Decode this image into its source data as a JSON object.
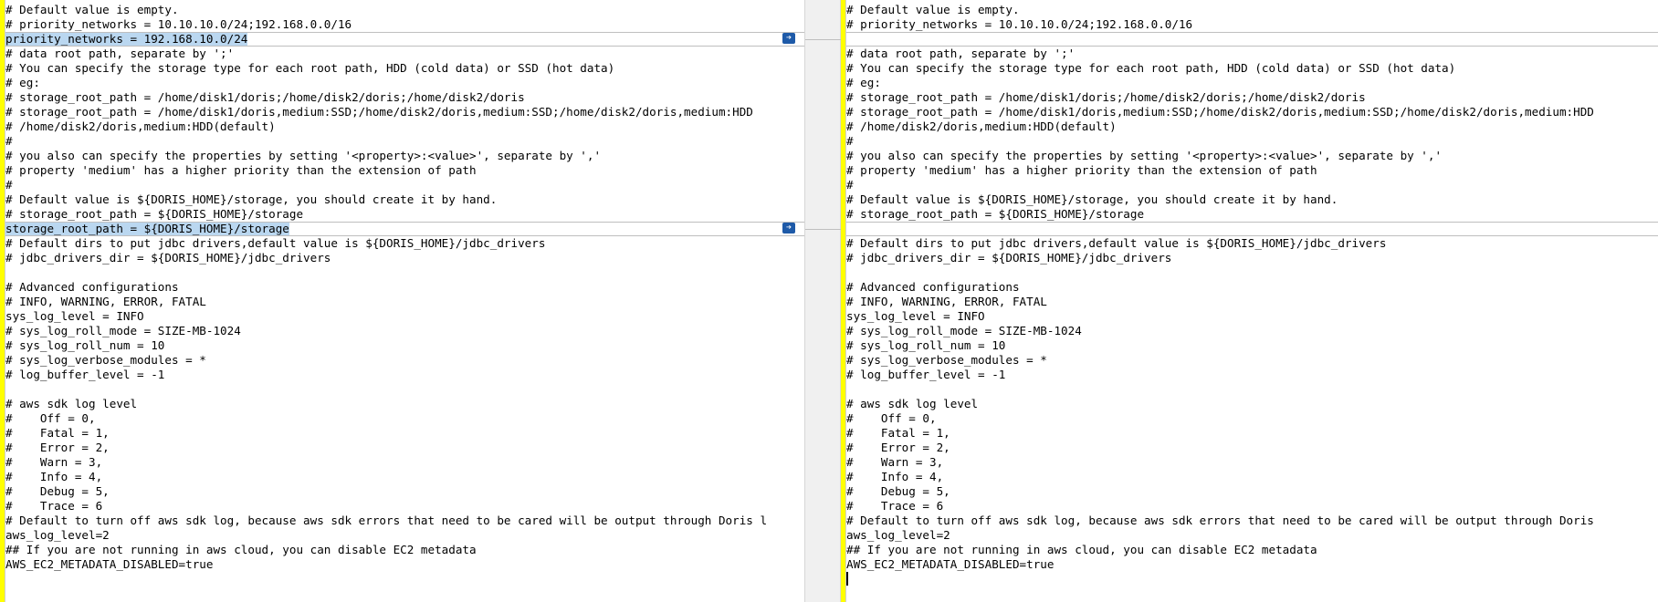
{
  "left": {
    "lines": [
      {
        "text": "# Default value is empty.",
        "changed": false
      },
      {
        "text": "# priority_networks = 10.10.10.0/24;192.168.0.0/16",
        "changed": false
      },
      {
        "text": "priority_networks = 192.168.10.0/24",
        "changed": true
      },
      {
        "text": "# data root path, separate by ';'",
        "changed": false
      },
      {
        "text": "# You can specify the storage type for each root path, HDD (cold data) or SSD (hot data)",
        "changed": false
      },
      {
        "text": "# eg:",
        "changed": false
      },
      {
        "text": "# storage_root_path = /home/disk1/doris;/home/disk2/doris;/home/disk2/doris",
        "changed": false
      },
      {
        "text": "# storage_root_path = /home/disk1/doris,medium:SSD;/home/disk2/doris,medium:SSD;/home/disk2/doris,medium:HDD",
        "changed": false
      },
      {
        "text": "# /home/disk2/doris,medium:HDD(default)",
        "changed": false
      },
      {
        "text": "#",
        "changed": false
      },
      {
        "text": "# you also can specify the properties by setting '<property>:<value>', separate by ','",
        "changed": false
      },
      {
        "text": "# property 'medium' has a higher priority than the extension of path",
        "changed": false
      },
      {
        "text": "#",
        "changed": false
      },
      {
        "text": "# Default value is ${DORIS_HOME}/storage, you should create it by hand.",
        "changed": false
      },
      {
        "text": "# storage_root_path = ${DORIS_HOME}/storage",
        "changed": false
      },
      {
        "text": "storage_root_path = ${DORIS_HOME}/storage",
        "changed": true
      },
      {
        "text": "# Default dirs to put jdbc drivers,default value is ${DORIS_HOME}/jdbc_drivers",
        "changed": false
      },
      {
        "text": "# jdbc_drivers_dir = ${DORIS_HOME}/jdbc_drivers",
        "changed": false
      },
      {
        "text": "",
        "changed": false
      },
      {
        "text": "# Advanced configurations",
        "changed": false
      },
      {
        "text": "# INFO, WARNING, ERROR, FATAL",
        "changed": false
      },
      {
        "text": "sys_log_level = INFO",
        "changed": false
      },
      {
        "text": "# sys_log_roll_mode = SIZE-MB-1024",
        "changed": false
      },
      {
        "text": "# sys_log_roll_num = 10",
        "changed": false
      },
      {
        "text": "# sys_log_verbose_modules = *",
        "changed": false
      },
      {
        "text": "# log_buffer_level = -1",
        "changed": false
      },
      {
        "text": "",
        "changed": false
      },
      {
        "text": "# aws sdk log level",
        "changed": false
      },
      {
        "text": "#    Off = 0,",
        "changed": false
      },
      {
        "text": "#    Fatal = 1,",
        "changed": false
      },
      {
        "text": "#    Error = 2,",
        "changed": false
      },
      {
        "text": "#    Warn = 3,",
        "changed": false
      },
      {
        "text": "#    Info = 4,",
        "changed": false
      },
      {
        "text": "#    Debug = 5,",
        "changed": false
      },
      {
        "text": "#    Trace = 6",
        "changed": false
      },
      {
        "text": "# Default to turn off aws sdk log, because aws sdk errors that need to be cared will be output through Doris l",
        "changed": false
      },
      {
        "text": "aws_log_level=2",
        "changed": false
      },
      {
        "text": "## If you are not running in aws cloud, you can disable EC2 metadata",
        "changed": false
      },
      {
        "text": "AWS_EC2_METADATA_DISABLED=true",
        "changed": false
      }
    ]
  },
  "right": {
    "lines": [
      {
        "text": "# Default value is empty.",
        "changed": false
      },
      {
        "text": "# priority_networks = 10.10.10.0/24;192.168.0.0/16",
        "changed": false
      },
      {
        "text": "",
        "changed": true
      },
      {
        "text": "# data root path, separate by ';'",
        "changed": false
      },
      {
        "text": "# You can specify the storage type for each root path, HDD (cold data) or SSD (hot data)",
        "changed": false
      },
      {
        "text": "# eg:",
        "changed": false
      },
      {
        "text": "# storage_root_path = /home/disk1/doris;/home/disk2/doris;/home/disk2/doris",
        "changed": false
      },
      {
        "text": "# storage_root_path = /home/disk1/doris,medium:SSD;/home/disk2/doris,medium:SSD;/home/disk2/doris,medium:HDD",
        "changed": false
      },
      {
        "text": "# /home/disk2/doris,medium:HDD(default)",
        "changed": false
      },
      {
        "text": "#",
        "changed": false
      },
      {
        "text": "# you also can specify the properties by setting '<property>:<value>', separate by ','",
        "changed": false
      },
      {
        "text": "# property 'medium' has a higher priority than the extension of path",
        "changed": false
      },
      {
        "text": "#",
        "changed": false
      },
      {
        "text": "# Default value is ${DORIS_HOME}/storage, you should create it by hand.",
        "changed": false
      },
      {
        "text": "# storage_root_path = ${DORIS_HOME}/storage",
        "changed": false
      },
      {
        "text": "",
        "changed": true
      },
      {
        "text": "# Default dirs to put jdbc drivers,default value is ${DORIS_HOME}/jdbc_drivers",
        "changed": false
      },
      {
        "text": "# jdbc_drivers_dir = ${DORIS_HOME}/jdbc_drivers",
        "changed": false
      },
      {
        "text": "",
        "changed": false
      },
      {
        "text": "# Advanced configurations",
        "changed": false
      },
      {
        "text": "# INFO, WARNING, ERROR, FATAL",
        "changed": false
      },
      {
        "text": "sys_log_level = INFO",
        "changed": false
      },
      {
        "text": "# sys_log_roll_mode = SIZE-MB-1024",
        "changed": false
      },
      {
        "text": "# sys_log_roll_num = 10",
        "changed": false
      },
      {
        "text": "# sys_log_verbose_modules = *",
        "changed": false
      },
      {
        "text": "# log_buffer_level = -1",
        "changed": false
      },
      {
        "text": "",
        "changed": false
      },
      {
        "text": "# aws sdk log level",
        "changed": false
      },
      {
        "text": "#    Off = 0,",
        "changed": false
      },
      {
        "text": "#    Fatal = 1,",
        "changed": false
      },
      {
        "text": "#    Error = 2,",
        "changed": false
      },
      {
        "text": "#    Warn = 3,",
        "changed": false
      },
      {
        "text": "#    Info = 4,",
        "changed": false
      },
      {
        "text": "#    Debug = 5,",
        "changed": false
      },
      {
        "text": "#    Trace = 6",
        "changed": false
      },
      {
        "text": "# Default to turn off aws sdk log, because aws sdk errors that need to be cared will be output through Doris",
        "changed": false
      },
      {
        "text": "aws_log_level=2",
        "changed": false
      },
      {
        "text": "## If you are not running in aws cloud, you can disable EC2 metadata",
        "changed": false
      },
      {
        "text": "AWS_EC2_METADATA_DISABLED=true",
        "changed": false
      },
      {
        "text": "",
        "changed": false
      }
    ]
  },
  "icons": {
    "copy_right": "arrow-right-icon",
    "copy_left": "arrow-left-icon"
  },
  "colors": {
    "gutter": "#ffff00",
    "selection": "#bad7f0",
    "arrow_button": "#1e5aa8"
  }
}
